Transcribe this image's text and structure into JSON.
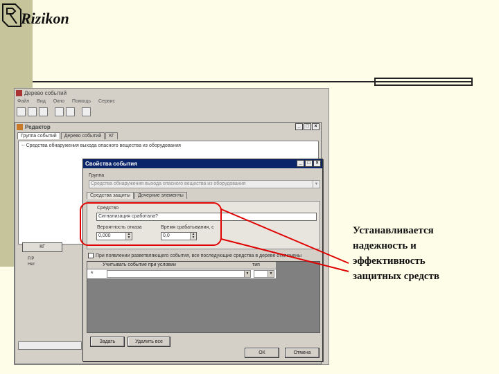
{
  "logo": {
    "text": "Rizikon"
  },
  "app": {
    "title": "Дерево событий",
    "menu": [
      "Файл",
      "Вид",
      "Окно",
      "Помощь",
      "Сервис"
    ]
  },
  "editor": {
    "title": "Редактор",
    "tabs": [
      "Группа событий",
      "Дерево событий",
      "КГ"
    ],
    "tree_item": "-- Средства обнаружения выхода опасного вещества из оборудования",
    "kg_button": "КГ",
    "tree_mini": [
      "F/Р",
      "Нет"
    ]
  },
  "dialog": {
    "title": "Свойства события",
    "group_label": "Группа",
    "group_value": "Средства обнаружения выхода опасного вещества из оборудования",
    "tabs": [
      "Средства защиты",
      "Дочерние элементы"
    ],
    "subgroup_label": "Средство",
    "name_value": "Сигнализация сработала?",
    "prob_label": "Вероятность отказа",
    "prob_value": "0,000",
    "time_label": "Время срабатывания, с",
    "time_value": "0,0",
    "checkbox_label": "При появлении разветвляющего события, все последующие средства в дереве отключены",
    "grid_col1": "Учитывать событие при условии",
    "grid_col2": "тип",
    "grid_star": "*",
    "add_button": "Задать",
    "edit_button": "Удалить все",
    "ok_button": "ОК",
    "cancel_button": "Отмена"
  },
  "caption": {
    "line1": "Устанавливается",
    "line2": "надежность и",
    "line3": "эффективность",
    "line4": "защитных средств"
  },
  "colors": {
    "accent": "#e00000",
    "background": "#fefde8",
    "band": "#c6c49a"
  }
}
